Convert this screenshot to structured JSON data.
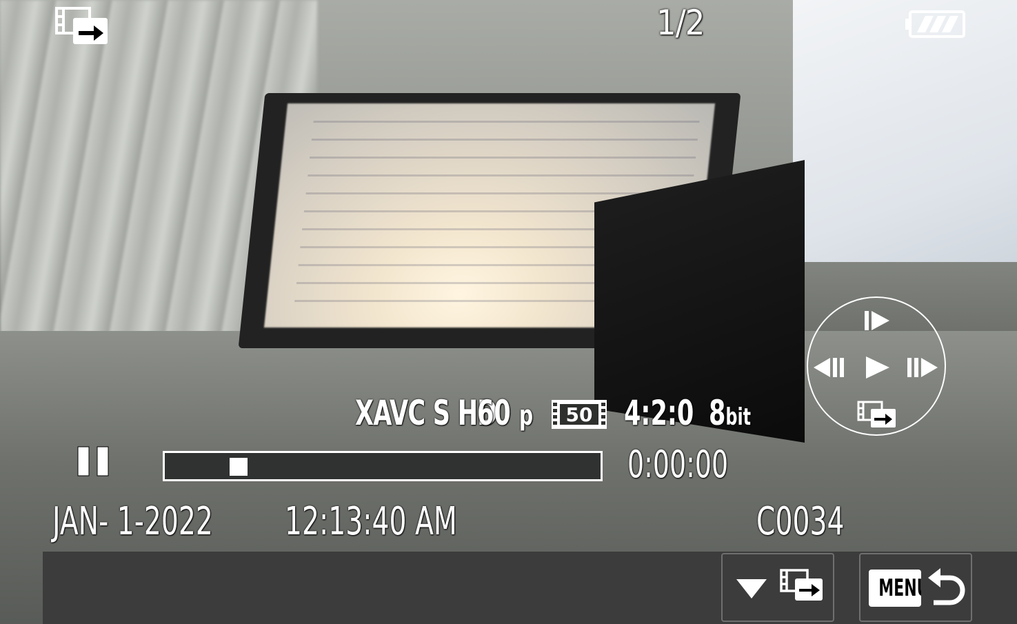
{
  "header": {
    "mode_icon": "video-playback-icon",
    "counter": "1/2",
    "battery_icon": "battery-full-icon"
  },
  "recording_info": {
    "format": "XAVC S HD",
    "frame_rate": "60",
    "frame_rate_suffix": "p",
    "bitrate": "50",
    "bitrate_icon": "bitrate-icon",
    "chroma": "4:2:0",
    "bit_depth": "8",
    "bit_depth_unit": "bit"
  },
  "playback": {
    "state_icon": "pause-icon",
    "progress_fraction": 0.17,
    "timecode": "0:00:00"
  },
  "file_info": {
    "date": "JAN- 1-2022",
    "time": "12:13:40 AM",
    "file_number": "C0034"
  },
  "control_dial": {
    "up_icon": "slow-play-icon",
    "left_icon": "frame-back-icon",
    "center_icon": "play-icon",
    "right_icon": "frame-forward-icon",
    "down_icon": "video-playback-icon"
  },
  "soft_buttons": {
    "select": {
      "icons": [
        "triangle-down-icon",
        "video-playback-icon"
      ]
    },
    "menu": {
      "label": "MENU",
      "icon": "return-arrow-icon"
    }
  }
}
